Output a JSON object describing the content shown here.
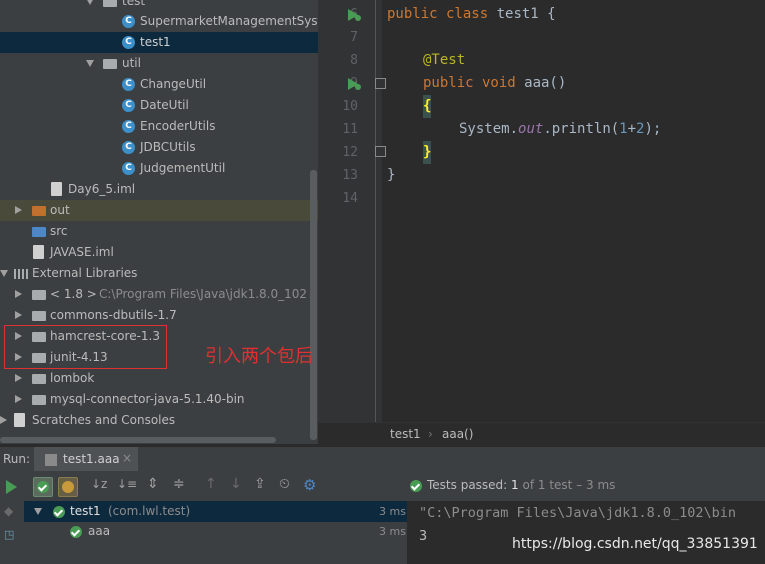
{
  "project_tree": {
    "rows": [
      {
        "label": "test",
        "type": "folder"
      },
      {
        "label": "SupermarketManagementSyste",
        "type": "class"
      },
      {
        "label": "test1",
        "type": "class"
      },
      {
        "label": "util",
        "type": "folder"
      },
      {
        "label": "ChangeUtil",
        "type": "class"
      },
      {
        "label": "DateUtil",
        "type": "class"
      },
      {
        "label": "EncoderUtils",
        "type": "class"
      },
      {
        "label": "JDBCUtils",
        "type": "class"
      },
      {
        "label": "JudgementUtil",
        "type": "class"
      },
      {
        "label": "Day6_5.iml",
        "type": "file"
      },
      {
        "label": "out",
        "type": "folder"
      },
      {
        "label": "src",
        "type": "folder"
      },
      {
        "label": "JAVASE.iml",
        "type": "file"
      },
      {
        "label": "External Libraries",
        "type": "library"
      },
      {
        "label": "< 1.8 >",
        "detail": "C:\\Program Files\\Java\\jdk1.8.0_102",
        "type": "library"
      },
      {
        "label": "commons-dbutils-1.7",
        "type": "library"
      },
      {
        "label": "hamcrest-core-1.3",
        "type": "library"
      },
      {
        "label": "junit-4.13",
        "type": "library"
      },
      {
        "label": "lombok",
        "type": "library"
      },
      {
        "label": "mysql-connector-java-5.1.40-bin",
        "type": "library"
      },
      {
        "label": "Scratches and Consoles",
        "type": "scratch"
      }
    ]
  },
  "annotation": "引入两个包后 运行正常",
  "editor": {
    "line_numbers": [
      "6",
      "7",
      "8",
      "9",
      "10",
      "11",
      "12",
      "13",
      "14"
    ],
    "code": {
      "l6_kw": "public class",
      "l6_rest": " test1 {",
      "l8": "@Test",
      "l9_kw": "public void",
      "l9_rest": " aaa()",
      "l10": "{",
      "l11_a": "System.",
      "l11_b": "out",
      "l11_c": ".println(",
      "l11_d": "1",
      "l11_e": "+",
      "l11_f": "2",
      "l11_g": ");",
      "l12": "}",
      "l13": "}"
    },
    "breadcrumb": [
      "test1",
      "aaa()"
    ]
  },
  "run": {
    "label": "Run:",
    "tab": "test1.aaa",
    "status_prefix": "Tests passed:",
    "status_count": "1",
    "status_rest": "of 1 test – 3 ms",
    "results": [
      {
        "name": "test1",
        "detail": "(com.lwl.test)",
        "time": "3 ms"
      },
      {
        "name": "aaa",
        "detail": "",
        "time": "3 ms"
      }
    ],
    "console": [
      "\"C:\\Program Files\\Java\\jdk1.8.0_102\\bin",
      "3"
    ]
  },
  "watermark": "https://blog.csdn.net/qq_33851391",
  "colors": {
    "accent": "#3d8fc9",
    "pass": "#499c54",
    "annotation": "#e03030"
  }
}
